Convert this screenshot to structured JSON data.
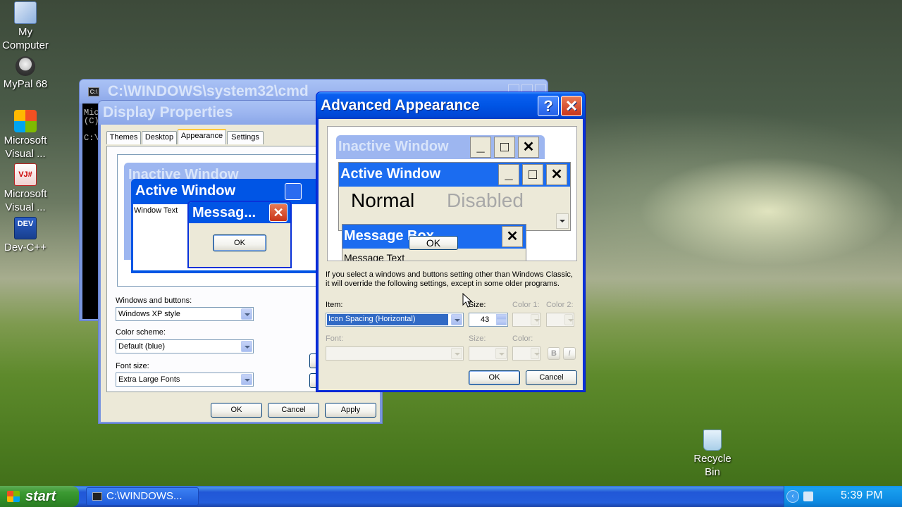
{
  "desktop": {
    "icons": [
      {
        "label": "My Computer"
      },
      {
        "label": "MyPal 68"
      },
      {
        "label": "Microsoft Visual ..."
      },
      {
        "label": "Microsoft Visual ..."
      },
      {
        "label": "Dev-C++"
      },
      {
        "label": "Recycle Bin"
      }
    ]
  },
  "cmd": {
    "title": "C:\\WINDOWS\\system32\\cmd",
    "lines": [
      "Mic",
      "(C)",
      "",
      "C:\\"
    ]
  },
  "display_properties": {
    "title": "Display Properties",
    "tabs": [
      "Themes",
      "Desktop",
      "Appearance",
      "Settings"
    ],
    "preview": {
      "inactive_title": "Inactive Window",
      "active_title": "Active Window",
      "window_text": "Window Text",
      "message_title": "Messag...",
      "ok": "OK"
    },
    "windows_buttons_label": "Windows and buttons:",
    "windows_buttons_value": "Windows XP style",
    "color_scheme_label": "Color scheme:",
    "color_scheme_value": "Default (blue)",
    "font_size_label": "Font size:",
    "font_size_value": "Extra Large Fonts",
    "ok": "OK",
    "cancel": "Cancel",
    "apply": "Apply"
  },
  "advanced": {
    "title": "Advanced Appearance",
    "help_glyph": "?",
    "preview": {
      "inactive_title": "Inactive Window",
      "active_title": "Active Window",
      "normal": "Normal",
      "disabled": "Disabled",
      "message_box_title": "Message Box",
      "message_text": "Message Text",
      "ok": "OK"
    },
    "info_line1": "If you select a windows and buttons setting other than Windows Classic,",
    "info_line2": "it will override the following settings, except in some older programs.",
    "item_label": "Item:",
    "item_value": "Icon Spacing (Horizontal)",
    "size_label": "Size:",
    "size_value": "43",
    "color1_label": "Color 1:",
    "color2_label": "Color 2:",
    "font_label": "Font:",
    "font_size_label": "Size:",
    "font_color_label": "Color:",
    "bold": "B",
    "italic": "I",
    "ok": "OK",
    "cancel": "Cancel"
  },
  "taskbar": {
    "start": "start",
    "task_label": "C:\\WINDOWS...",
    "clock": "5:39 PM"
  },
  "colors": {
    "xp_blue": "#0055e5",
    "xp_face": "#ece9d8",
    "close_red": "#c8351a",
    "start_green": "#3c9a33"
  }
}
